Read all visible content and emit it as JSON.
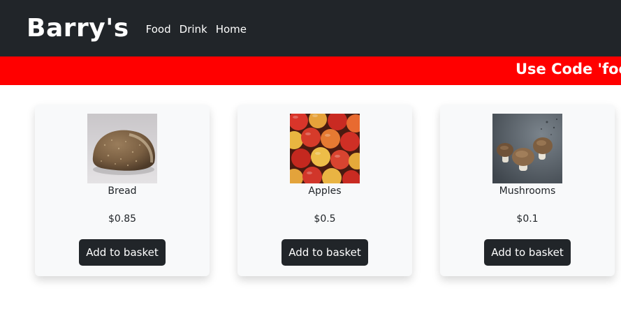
{
  "navbar": {
    "brand": "Barry's",
    "links": [
      "Food",
      "Drink",
      "Home"
    ],
    "background": "#212529"
  },
  "promo": {
    "text": "Use Code 'foo",
    "background": "#ff0000"
  },
  "products": [
    {
      "name": "Bread",
      "price": "$0.85",
      "button_label": "Add to basket",
      "image": "bread-image"
    },
    {
      "name": "Apples",
      "price": "$0.5",
      "button_label": "Add to basket",
      "image": "apples-image"
    },
    {
      "name": "Mushrooms",
      "price": "$0.1",
      "button_label": "Add to basket",
      "image": "mushrooms-image"
    }
  ]
}
